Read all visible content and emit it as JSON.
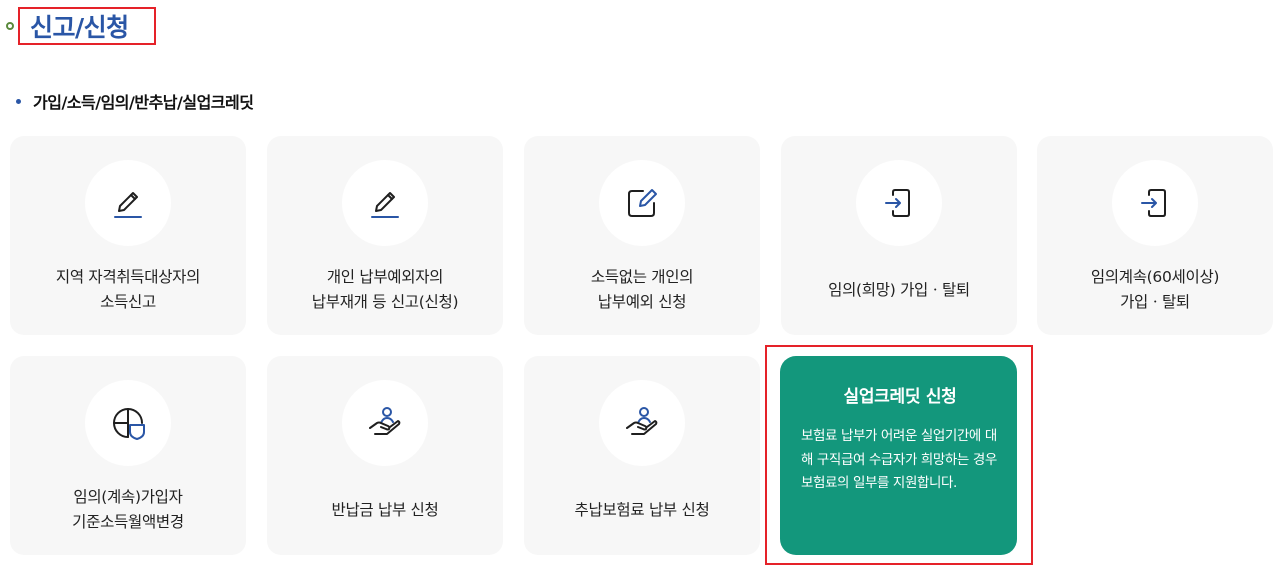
{
  "section": {
    "title": "신고/신청",
    "subtitle": "가입/소득/임의/반추납/실업크레딧"
  },
  "cards": [
    {
      "label": "지역 자격취득대상자의\n소득신고",
      "icon": "pencil-icon"
    },
    {
      "label": "개인 납부예외자의\n납부재개 등 신고(신청)",
      "icon": "pencil-icon"
    },
    {
      "label": "소득없는 개인의\n납부예외 신청",
      "icon": "edit-square-icon"
    },
    {
      "label": "임의(희망) 가입ㆍ탈퇴",
      "icon": "sign-in-icon"
    },
    {
      "label": "임의계속(60세이상)\n가입ㆍ탈퇴",
      "icon": "sign-in-icon"
    },
    {
      "label": "임의(계속)가입자\n기준소득월액변경",
      "icon": "globe-shield-icon"
    },
    {
      "label": "반납금 납부 신청",
      "icon": "hand-person-icon"
    },
    {
      "label": "추납보험료 납부 신청",
      "icon": "hand-person-icon"
    }
  ],
  "credit_card": {
    "title": "실업크레딧 신청",
    "description": "보험료 납부가 어려운 실업기간에 대해 구직급여 수급자가 희망하는 경우 보험료의 일부를 지원합니다."
  },
  "colors": {
    "accent_blue": "#2a56a6",
    "highlight_red": "#e52229",
    "credit_green": "#13977c",
    "card_bg": "#f7f7f7"
  }
}
